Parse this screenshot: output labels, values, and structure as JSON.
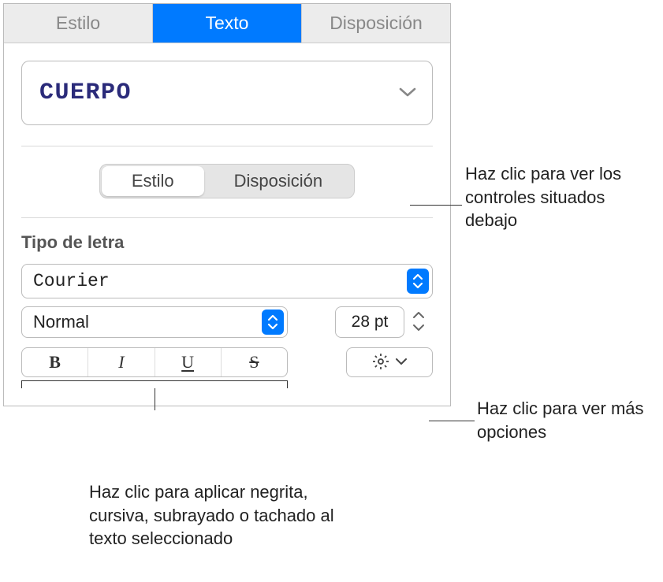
{
  "top_tabs": {
    "style": "Estilo",
    "text": "Texto",
    "layout": "Disposición"
  },
  "paragraph_style": {
    "label": "CUERPO"
  },
  "sub_tabs": {
    "style": "Estilo",
    "layout": "Disposición"
  },
  "font": {
    "section_label": "Tipo de letra",
    "name": "Courier",
    "weight": "Normal",
    "size": "28 pt"
  },
  "bius": {
    "bold": "B",
    "italic": "I",
    "underline": "U",
    "strike": "S"
  },
  "callouts": {
    "segmented": "Haz clic para ver los controles situados debajo",
    "gear": "Haz clic para ver más opciones",
    "bius": "Haz clic para aplicar negrita, cursiva, subrayado o tachado al texto seleccionado"
  }
}
